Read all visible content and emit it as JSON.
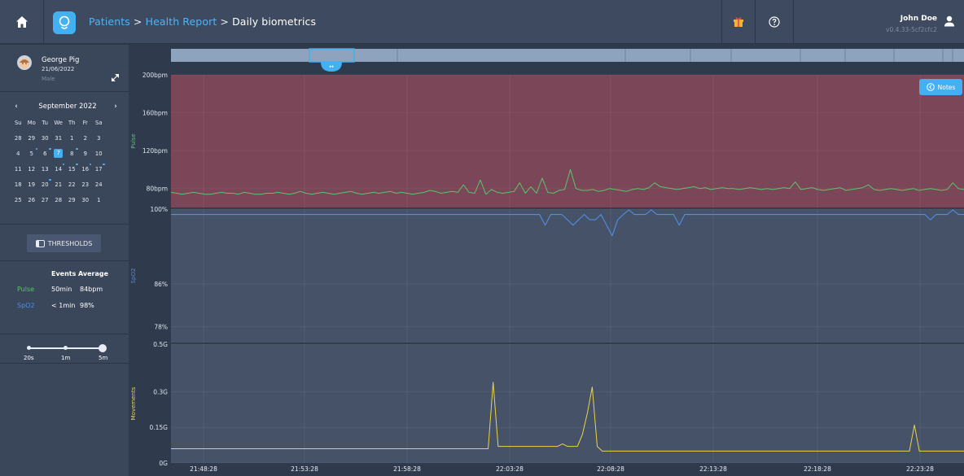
{
  "header": {
    "breadcrumb": [
      "Patients",
      "Health Report",
      "Daily biometrics"
    ],
    "separator": ">",
    "user_name": "John Doe",
    "version": "v0.4.33-5cf2cfc2",
    "icons": [
      "home-icon",
      "app-logo-icon",
      "gift-icon",
      "help-icon",
      "user-icon"
    ]
  },
  "patient": {
    "name": "George Pig",
    "dob": "21/06/2022",
    "sex": "Male"
  },
  "calendar": {
    "month": "September 2022",
    "prev": "‹",
    "next": "›",
    "weekdays": [
      "Su",
      "Mo",
      "Tu",
      "We",
      "Th",
      "Fr",
      "Sa"
    ],
    "weeks": [
      [
        "28",
        "29",
        "30",
        "31",
        "1",
        "2",
        "3"
      ],
      [
        "4",
        "5",
        "6",
        "7",
        "8",
        "9",
        "10"
      ],
      [
        "11",
        "12",
        "13",
        "14",
        "15",
        "16",
        "17"
      ],
      [
        "18",
        "19",
        "20",
        "21",
        "22",
        "23",
        "24"
      ],
      [
        "25",
        "26",
        "27",
        "28",
        "29",
        "30",
        "1"
      ]
    ],
    "selected": "7",
    "days_with_data": [
      "5",
      "6",
      "8",
      "14",
      "15",
      "16",
      "17",
      "20"
    ]
  },
  "thresholds_label": "THRESHOLDS",
  "stats": {
    "headers": {
      "events": "Events",
      "average": "Average"
    },
    "rows": [
      {
        "label": "Pulse",
        "events": "50min",
        "average": "84bpm",
        "color": "#5cc46a"
      },
      {
        "label": "SpO2",
        "events": "< 1min",
        "average": "98%",
        "color": "#4f8fe6"
      }
    ]
  },
  "zoom": {
    "options": [
      "20s",
      "1m",
      "5m"
    ],
    "selected": "5m"
  },
  "notes_label": "Notes",
  "chart_data": {
    "type": "line",
    "x_ticks": [
      "21:48:28",
      "21:53:28",
      "21:58:28",
      "22:03:28",
      "22:08:28",
      "22:13:28",
      "22:18:28",
      "22:23:28"
    ],
    "panels": [
      {
        "ylabel": "Pulse",
        "ylim": [
          60,
          200
        ],
        "y_ticks": [
          "200bpm",
          "160bpm",
          "120bpm",
          "80bpm"
        ],
        "y_tick_values": [
          200,
          160,
          120,
          80
        ],
        "color": "#5cc46a",
        "band_color": "#7a4658",
        "values": [
          76,
          75,
          74,
          75,
          76,
          75,
          74,
          74,
          75,
          76,
          75,
          75,
          74,
          76,
          75,
          74,
          74,
          75,
          75,
          76,
          75,
          74,
          75,
          77,
          75,
          74,
          75,
          76,
          75,
          74,
          75,
          76,
          77,
          75,
          74,
          75,
          76,
          75,
          76,
          77,
          75,
          76,
          75,
          74,
          75,
          76,
          78,
          77,
          75,
          76,
          77,
          76,
          84,
          76,
          75,
          89,
          74,
          79,
          76,
          75,
          76,
          77,
          86,
          75,
          82,
          75,
          91,
          76,
          75,
          78,
          79,
          100,
          80,
          78,
          78,
          79,
          77,
          78,
          80,
          79,
          78,
          77,
          79,
          80,
          79,
          81,
          86,
          82,
          81,
          80,
          79,
          80,
          81,
          82,
          80,
          81,
          79,
          80,
          81,
          80,
          80,
          79,
          80,
          81,
          80,
          79,
          80,
          79,
          80,
          81,
          80,
          87,
          79,
          80,
          81,
          79,
          78,
          79,
          80,
          81,
          78,
          79,
          80,
          81,
          84,
          79,
          78,
          79,
          80,
          79,
          78,
          79,
          80,
          78,
          79,
          80,
          79,
          78,
          79,
          86,
          80,
          79
        ]
      },
      {
        "ylabel": "SpO2",
        "ylim": [
          75,
          100
        ],
        "y_ticks": [
          "100%",
          "86%",
          "78%"
        ],
        "y_tick_values": [
          100,
          86,
          78
        ],
        "color": "#4f8fe6",
        "values": [
          99,
          99,
          99,
          99,
          99,
          99,
          99,
          99,
          99,
          99,
          99,
          99,
          99,
          99,
          99,
          99,
          99,
          99,
          99,
          99,
          99,
          99,
          99,
          99,
          99,
          99,
          99,
          99,
          99,
          99,
          99,
          99,
          99,
          99,
          99,
          99,
          99,
          99,
          99,
          99,
          99,
          99,
          99,
          99,
          99,
          99,
          99,
          99,
          99,
          99,
          99,
          99,
          99,
          99,
          99,
          99,
          99,
          99,
          99,
          99,
          99,
          99,
          99,
          99,
          99,
          99,
          99,
          97,
          99,
          99,
          99,
          98,
          97,
          98,
          99,
          98,
          98,
          99,
          97,
          95,
          98,
          99,
          100,
          99,
          99,
          99,
          100,
          99,
          99,
          99,
          99,
          97,
          99,
          99,
          99,
          99,
          99,
          99,
          99,
          99,
          99,
          99,
          99,
          99,
          99,
          99,
          99,
          99,
          99,
          99,
          99,
          99,
          99,
          99,
          99,
          99,
          99,
          99,
          99,
          99,
          99,
          99,
          99,
          99,
          99,
          99,
          99,
          99,
          99,
          99,
          99,
          99,
          99,
          99,
          99,
          99,
          98,
          99,
          99,
          99,
          100,
          99,
          99
        ]
      },
      {
        "ylabel": "Movements",
        "ylim": [
          0,
          0.5
        ],
        "y_ticks": [
          "0.5G",
          "0.3G",
          "0.15G",
          "0G"
        ],
        "y_tick_values": [
          0.5,
          0.3,
          0.15,
          0
        ],
        "color": "#e8d44a",
        "values": [
          0.06,
          0.06,
          0.06,
          0.06,
          0.06,
          0.06,
          0.06,
          0.06,
          0.06,
          0.06,
          0.06,
          0.06,
          0.06,
          0.06,
          0.06,
          0.06,
          0.06,
          0.06,
          0.06,
          0.06,
          0.06,
          0.06,
          0.06,
          0.06,
          0.06,
          0.06,
          0.06,
          0.06,
          0.06,
          0.06,
          0.06,
          0.06,
          0.06,
          0.06,
          0.06,
          0.06,
          0.06,
          0.06,
          0.06,
          0.06,
          0.06,
          0.06,
          0.06,
          0.06,
          0.06,
          0.06,
          0.06,
          0.06,
          0.06,
          0.06,
          0.06,
          0.06,
          0.06,
          0.06,
          0.06,
          0.06,
          0.06,
          0.06,
          0.06,
          0.06,
          0.06,
          0.06,
          0.06,
          0.06,
          0.06,
          0.34,
          0.07,
          0.07,
          0.07,
          0.07,
          0.07,
          0.07,
          0.07,
          0.07,
          0.07,
          0.07,
          0.07,
          0.07,
          0.07,
          0.08,
          0.07,
          0.07,
          0.07,
          0.12,
          0.21,
          0.32,
          0.07,
          0.05,
          0.05,
          0.05,
          0.05,
          0.05,
          0.05,
          0.05,
          0.05,
          0.05,
          0.05,
          0.05,
          0.05,
          0.05,
          0.05,
          0.05,
          0.05,
          0.05,
          0.05,
          0.05,
          0.05,
          0.05,
          0.05,
          0.05,
          0.05,
          0.05,
          0.05,
          0.05,
          0.05,
          0.05,
          0.05,
          0.05,
          0.05,
          0.05,
          0.05,
          0.05,
          0.05,
          0.05,
          0.05,
          0.05,
          0.05,
          0.05,
          0.05,
          0.05,
          0.05,
          0.05,
          0.05,
          0.05,
          0.05,
          0.05,
          0.05,
          0.05,
          0.05,
          0.05,
          0.05,
          0.05,
          0.05,
          0.05,
          0.05,
          0.05,
          0.05,
          0.05,
          0.05,
          0.05,
          0.16,
          0.05,
          0.05,
          0.05,
          0.05,
          0.05,
          0.05,
          0.05,
          0.05,
          0.05,
          0.05
        ]
      }
    ]
  }
}
